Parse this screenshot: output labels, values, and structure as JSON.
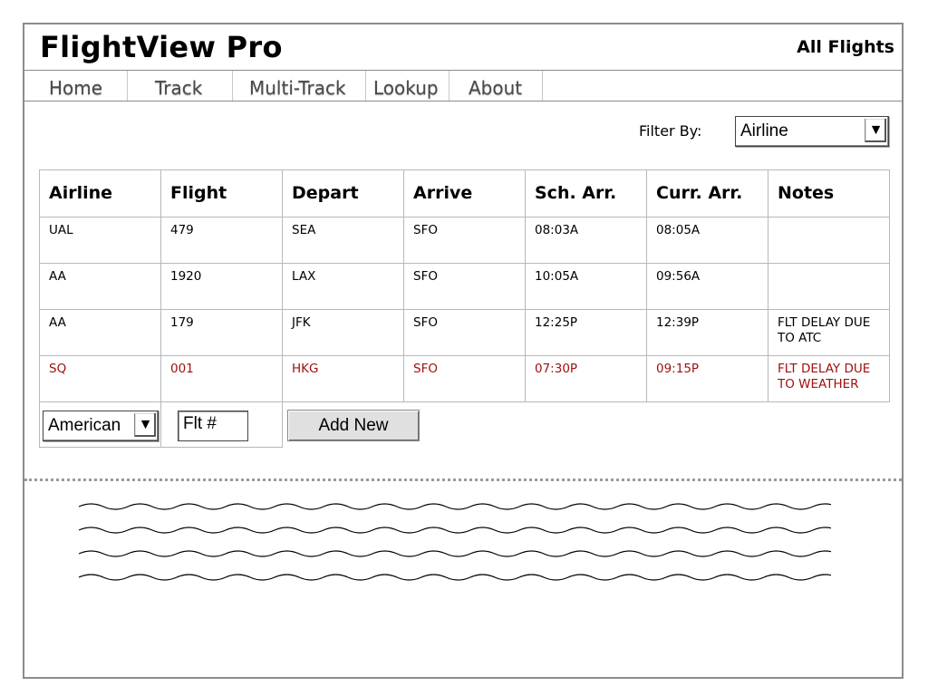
{
  "app": {
    "title": "FlightView Pro",
    "view_name": "All Flights"
  },
  "nav": {
    "tabs": [
      {
        "label": "Home"
      },
      {
        "label": "Track"
      },
      {
        "label": "Multi-Track"
      },
      {
        "label": "Lookup"
      },
      {
        "label": "About"
      }
    ]
  },
  "filter": {
    "label": "Filter By:",
    "selected": "Airline",
    "arrow": "▼"
  },
  "table": {
    "headers": [
      "Airline",
      "Flight",
      "Depart",
      "Arrive",
      "Sch. Arr.",
      "Curr. Arr.",
      "Notes"
    ],
    "rows": [
      {
        "cells": [
          "UAL",
          "479",
          "SEA",
          "SFO",
          "08:03A",
          "08:05A",
          ""
        ],
        "status": "normal"
      },
      {
        "cells": [
          "AA",
          "1920",
          "LAX",
          "SFO",
          "10:05A",
          "09:56A",
          ""
        ],
        "status": "normal"
      },
      {
        "cells": [
          "AA",
          "179",
          "JFK",
          "SFO",
          "12:25P",
          "12:39P",
          "FLT DELAY DUE TO ATC"
        ],
        "status": "normal"
      },
      {
        "cells": [
          "SQ",
          "001",
          "HKG",
          "SFO",
          "07:30P",
          "09:15P",
          "FLT DELAY DUE TO WEATHER"
        ],
        "status": "delayed"
      }
    ]
  },
  "new_entry": {
    "airline_selected": "American",
    "arrow": "▼",
    "flight_value": "Flt #",
    "add_button_label": "Add New"
  },
  "colors": {
    "delayed_text": "#a01010",
    "border": "#8c8c8c"
  },
  "placeholder_content": {
    "line_count": 4
  }
}
